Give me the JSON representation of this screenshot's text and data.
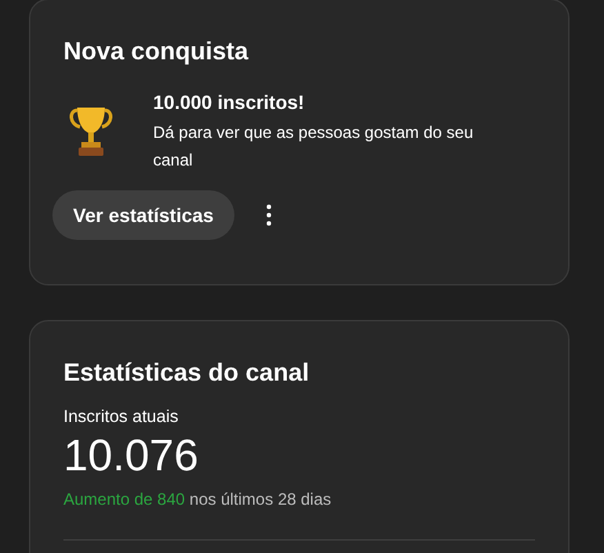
{
  "achievement_card": {
    "title": "Nova conquista",
    "headline": "10.000 inscritos!",
    "message": "Dá para ver que as pessoas gostam do seu canal",
    "button": "Ver estatísticas"
  },
  "stats_card": {
    "title": "Estatísticas do canal",
    "metric_label": "Inscritos atuais",
    "metric_value": "10.076",
    "growth_highlight": "Aumento de 840",
    "growth_rest": "nos últimos 28 dias"
  }
}
